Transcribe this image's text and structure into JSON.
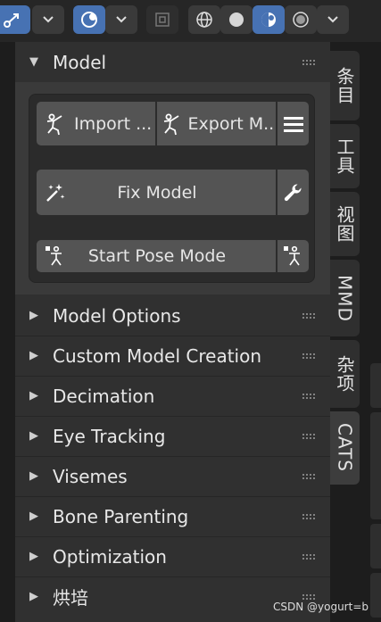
{
  "model_panel": {
    "title": "Model",
    "import_label": "Import ...",
    "export_label": "Export M...",
    "fix_label": "Fix Model",
    "pose_label": "Start Pose Mode"
  },
  "sections": [
    {
      "label": "Model Options"
    },
    {
      "label": "Custom Model Creation"
    },
    {
      "label": "Decimation"
    },
    {
      "label": "Eye Tracking"
    },
    {
      "label": "Visemes"
    },
    {
      "label": "Bone Parenting"
    },
    {
      "label": "Optimization"
    },
    {
      "label": "烘培"
    }
  ],
  "tabs": [
    {
      "label": "条目"
    },
    {
      "label": "工具"
    },
    {
      "label": "视图"
    },
    {
      "label": "MMD"
    },
    {
      "label": "杂项"
    },
    {
      "label": "CATS",
      "active": true
    }
  ],
  "watermark": "CSDN @yogurt=b",
  "colors": {
    "accent": "#4772b3",
    "panel_bg": "#303030",
    "button_bg": "#545454"
  }
}
